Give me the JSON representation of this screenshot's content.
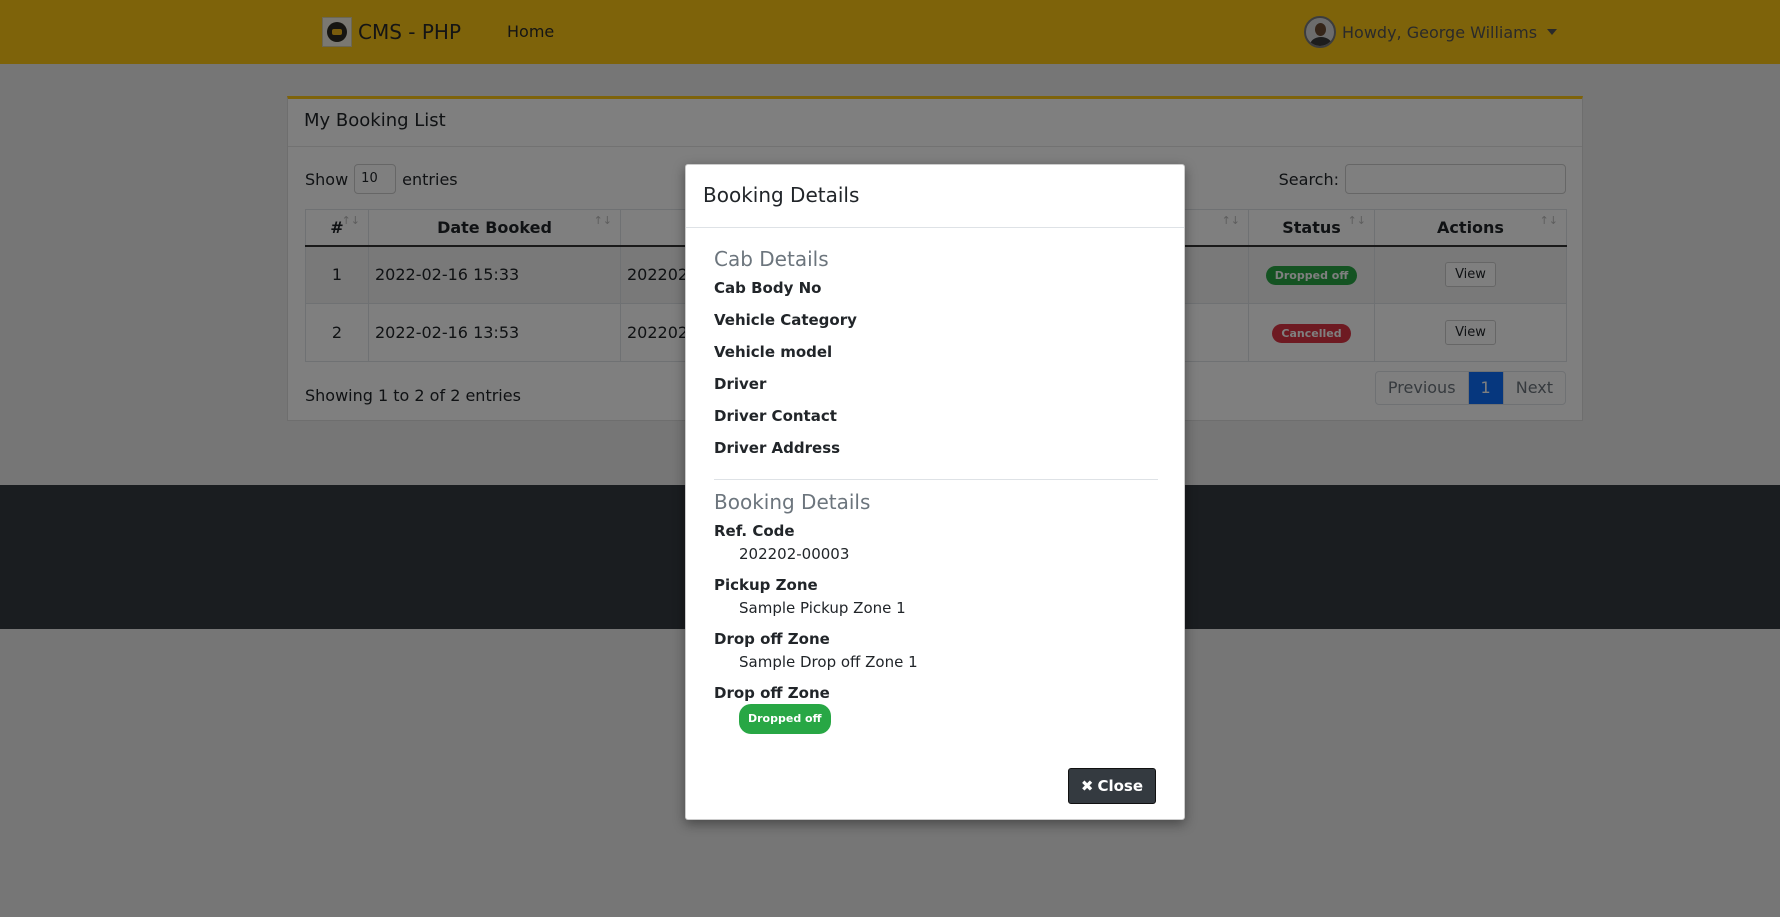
{
  "navbar": {
    "brand": "CMS - PHP",
    "home": "Home",
    "user": "Howdy, George Williams"
  },
  "card": {
    "title": "My Booking List",
    "show_label": "Show",
    "entries_value": "10",
    "entries_label": "entries",
    "search_label": "Search:",
    "columns": [
      "#",
      "Date Booked",
      "Status",
      "Actions"
    ],
    "rows": [
      {
        "num": "1",
        "date": "2022-02-16 15:33",
        "ref": "202202-",
        "status": "Dropped off",
        "action": "View"
      },
      {
        "num": "2",
        "date": "2022-02-16 13:53",
        "ref": "202202-",
        "status": "Cancelled",
        "action": "View"
      }
    ],
    "info": "Showing 1 to 2 of 2 entries",
    "pager": {
      "previous": "Previous",
      "page": "1",
      "next": "Next"
    }
  },
  "modal": {
    "title": "Booking Details",
    "cab_section": "Cab Details",
    "cab_fields": [
      "Cab Body No",
      "Vehicle Category",
      "Vehicle model",
      "Driver",
      "Driver Contact",
      "Driver Address"
    ],
    "booking_section": "Booking Details",
    "ref_label": "Ref. Code",
    "ref_value": "202202-00003",
    "pickup_label": "Pickup Zone",
    "pickup_value": "Sample Pickup Zone 1",
    "dropoff_label": "Drop off Zone",
    "dropoff_value": "Sample Drop off Zone 1",
    "status_label": "Drop off Zone",
    "status_value": "Dropped off",
    "close": "Close"
  },
  "colors": {
    "navbar": "#fcc615",
    "footer": "#343a40",
    "success": "#28a745",
    "danger": "#dc3545",
    "active_page": "#0d6efd"
  }
}
